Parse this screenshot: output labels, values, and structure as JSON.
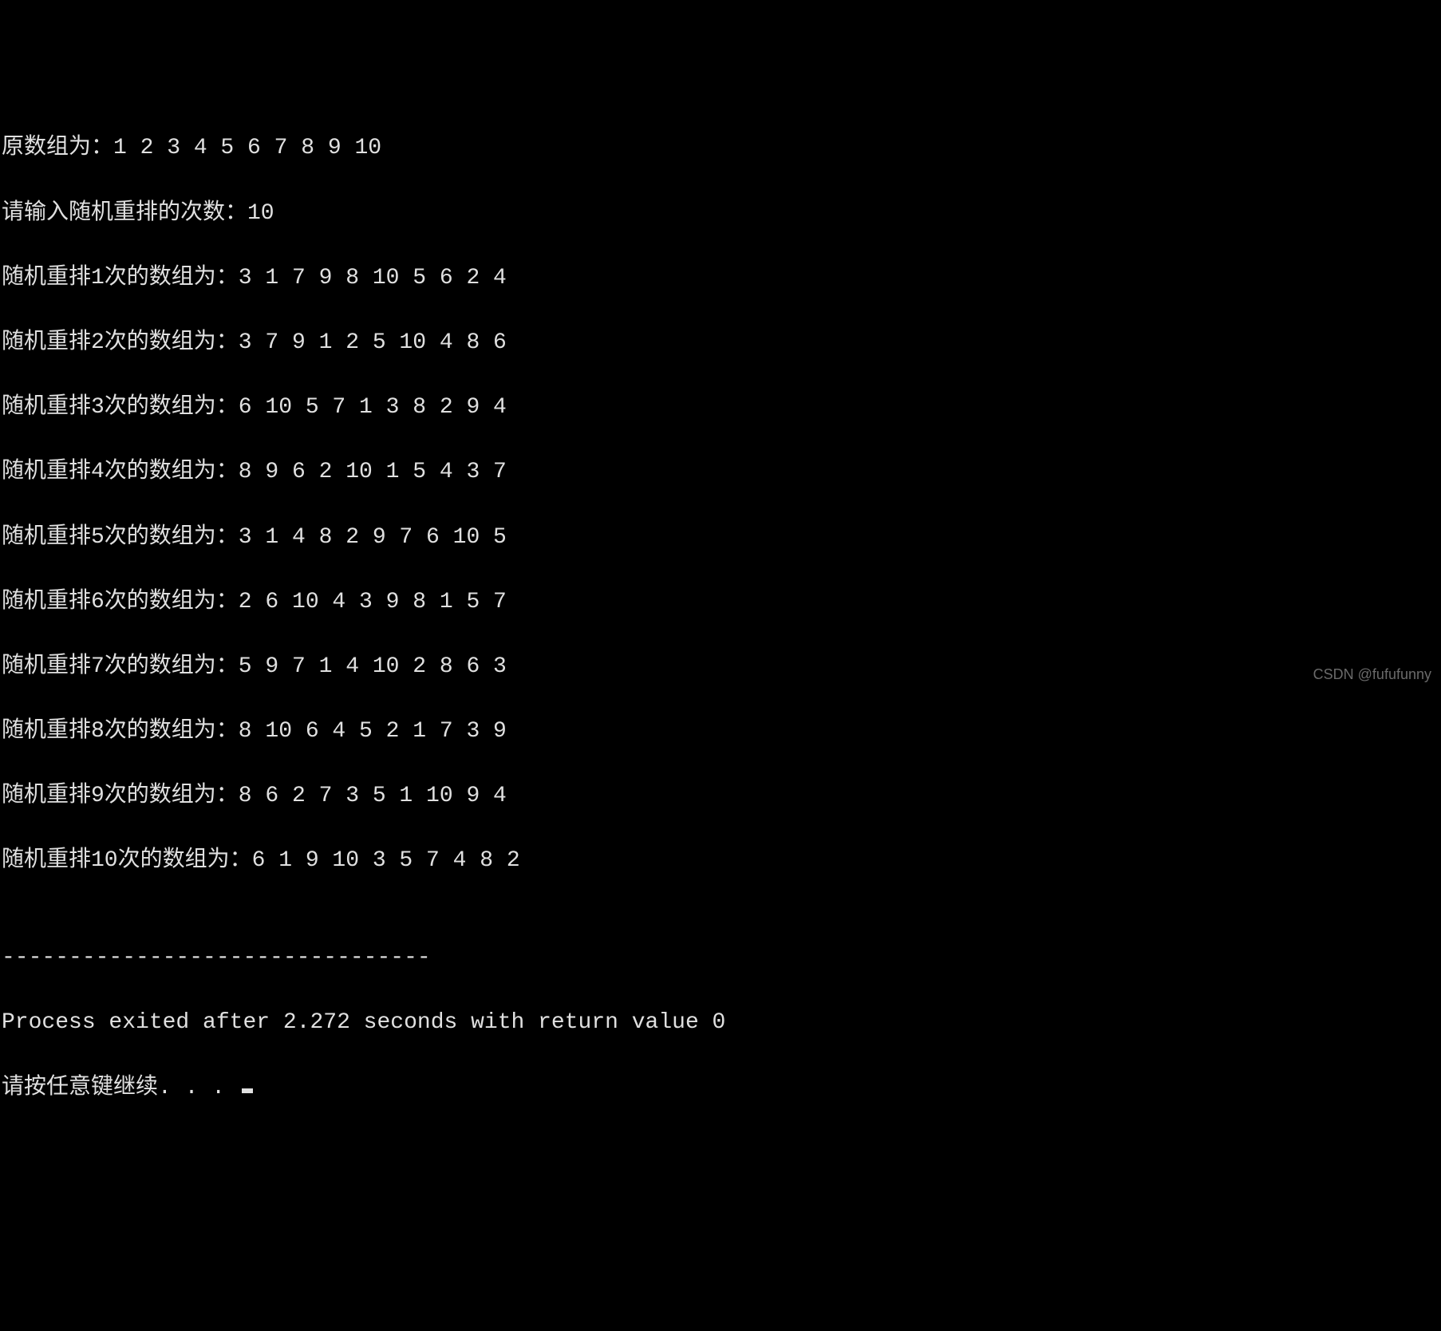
{
  "lines": {
    "l0": "原数组为：1 2 3 4 5 6 7 8 9 10",
    "l1": "请输入随机重排的次数：10",
    "l2": "随机重排1次的数组为：3 1 7 9 8 10 5 6 2 4",
    "l3": "随机重排2次的数组为：3 7 9 1 2 5 10 4 8 6",
    "l4": "随机重排3次的数组为：6 10 5 7 1 3 8 2 9 4",
    "l5": "随机重排4次的数组为：8 9 6 2 10 1 5 4 3 7",
    "l6": "随机重排5次的数组为：3 1 4 8 2 9 7 6 10 5",
    "l7": "随机重排6次的数组为：2 6 10 4 3 9 8 1 5 7",
    "l8": "随机重排7次的数组为：5 9 7 1 4 10 2 8 6 3",
    "l9": "随机重排8次的数组为：8 10 6 4 5 2 1 7 3 9",
    "l10": "随机重排9次的数组为：8 6 2 7 3 5 1 10 9 4",
    "l11": "随机重排10次的数组为：6 1 9 10 3 5 7 4 8 2",
    "blank": "",
    "sep": "--------------------------------",
    "exit": "Process exited after 2.272 seconds with return value 0",
    "prompt": "请按任意键继续. . . "
  },
  "watermark": "CSDN @fufufunny"
}
